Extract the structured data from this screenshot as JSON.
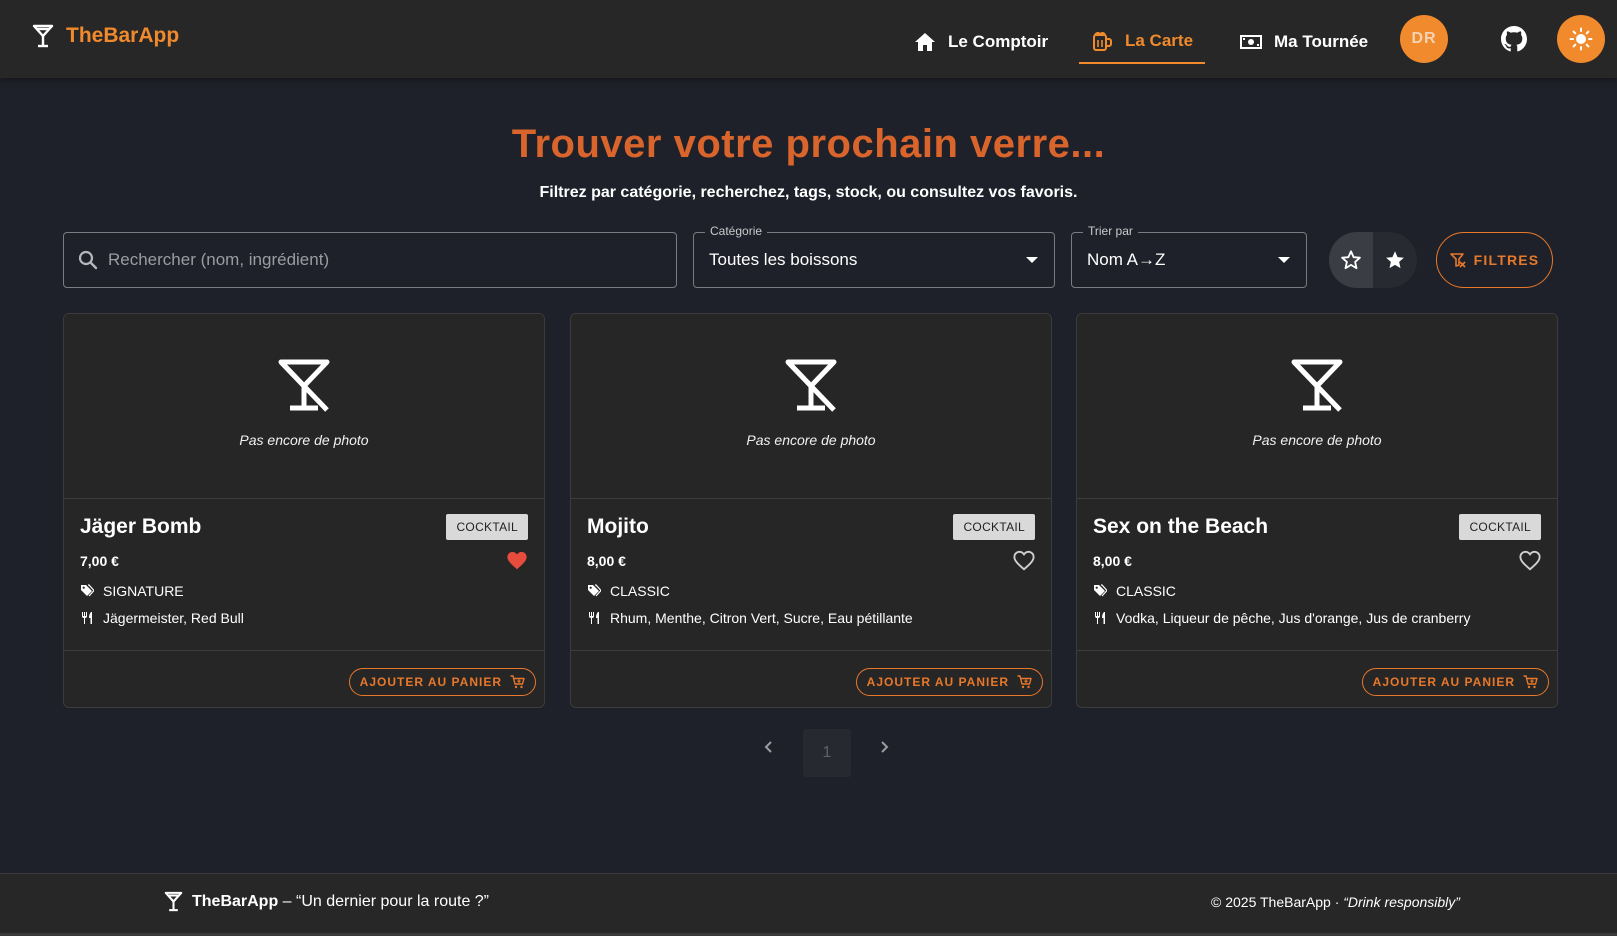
{
  "app": {
    "name": "TheBarApp"
  },
  "nav": {
    "items": [
      {
        "label": "Le Comptoir",
        "icon": "home-icon"
      },
      {
        "label": "La Carte",
        "icon": "beer-mug-icon",
        "active": true
      },
      {
        "label": "Ma Tournée",
        "icon": "money-icon"
      }
    ],
    "avatar_initials": "DR"
  },
  "hero": {
    "title": "Trouver votre prochain verre...",
    "subtitle": "Filtrez par catégorie, recherchez, tags, stock, ou consultez vos favoris."
  },
  "controls": {
    "search_placeholder": "Rechercher (nom, ingrédient)",
    "category_legend": "Catégorie",
    "category_value": "Toutes les boissons",
    "sort_legend": "Trier par",
    "sort_value": "Nom A→Z",
    "filters_label": "FILTRES"
  },
  "cards": [
    {
      "no_photo": "Pas encore de photo",
      "name": "Jäger Bomb",
      "badge": "COCKTAIL",
      "price": "7,00 €",
      "favorite": true,
      "tag": "SIGNATURE",
      "ingredients": "Jägermeister, Red Bull",
      "cart_label": "AJOUTER AU PANIER"
    },
    {
      "no_photo": "Pas encore de photo",
      "name": "Mojito",
      "badge": "COCKTAIL",
      "price": "8,00 €",
      "favorite": false,
      "tag": "CLASSIC",
      "ingredients": "Rhum, Menthe, Citron Vert, Sucre, Eau pétillante",
      "cart_label": "AJOUTER AU PANIER"
    },
    {
      "no_photo": "Pas encore de photo",
      "name": "Sex on the Beach",
      "badge": "COCKTAIL",
      "price": "8,00 €",
      "favorite": false,
      "tag": "CLASSIC",
      "ingredients": "Vodka, Liqueur de pêche, Jus d'orange, Jus de cranberry",
      "cart_label": "AJOUTER AU PANIER"
    }
  ],
  "pagination": {
    "current_page": "1"
  },
  "footer": {
    "brand": "TheBarApp",
    "tagline": " – “Un dernier pour la route ?”",
    "copyright": "© 2025 TheBarApp · ",
    "motto": "“Drink responsibly”"
  },
  "colors": {
    "accent": "#f08a2c",
    "title": "#d9652c",
    "background": "#1e2129",
    "surface": "#262626",
    "heart": "#e74c3c"
  }
}
